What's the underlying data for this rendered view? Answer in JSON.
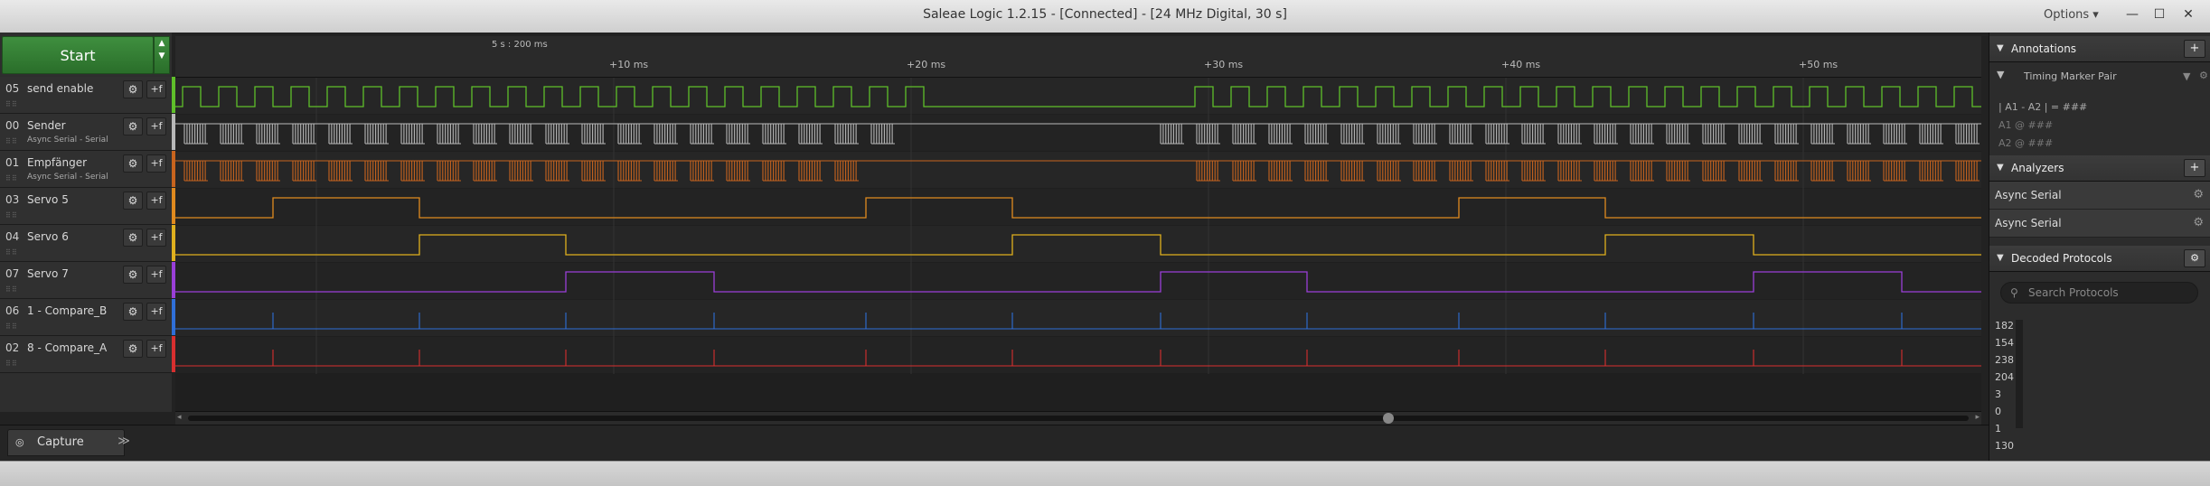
{
  "window": {
    "title": "Saleae Logic 1.2.15 - [Connected] - [24 MHz Digital, 30 s]",
    "options_label": "Options ▾",
    "minimize": "—",
    "maximize": "☐",
    "close": "✕"
  },
  "toolbar": {
    "start_label": "Start"
  },
  "ruler": {
    "zero_label": "5 s : 200 ms",
    "ticks": [
      "+10 ms",
      "+20 ms",
      "+30 ms",
      "+40 ms",
      "+50 ms"
    ]
  },
  "channels": [
    {
      "num": "05",
      "name": "send enable",
      "sub": "",
      "color": "#5fbf2a"
    },
    {
      "num": "00",
      "name": "Sender",
      "sub": "Async Serial - Serial",
      "color": "#b8b8b8"
    },
    {
      "num": "01",
      "name": "Empfänger",
      "sub": "Async Serial - Serial",
      "color": "#c8641e"
    },
    {
      "num": "03",
      "name": "Servo 5",
      "sub": "",
      "color": "#e08a1e"
    },
    {
      "num": "04",
      "name": "Servo 6",
      "sub": "",
      "color": "#e0b01e"
    },
    {
      "num": "07",
      "name": "Servo 7",
      "sub": "",
      "color": "#9a3fd8"
    },
    {
      "num": "06",
      "name": "1 - Compare_B",
      "sub": "",
      "color": "#2f6fd8"
    },
    {
      "num": "02",
      "name": "8 - Compare_A",
      "sub": "",
      "color": "#d82f2f"
    }
  ],
  "tabs": {
    "capture_label": "Capture",
    "more_label": "≫"
  },
  "annotations": {
    "title": "Annotations",
    "add": "+",
    "marker_pair": "Timing Marker Pair",
    "formula": "| A1 - A2 | = ###",
    "a1": "A1  @  ###",
    "a2": "A2  @  ###"
  },
  "analyzers": {
    "title": "Analyzers",
    "add": "+",
    "items": [
      "Async Serial",
      "Async Serial"
    ]
  },
  "decoded": {
    "title": "Decoded Protocols",
    "search_placeholder": "Search Protocols",
    "values": [
      "182",
      "154",
      "238",
      "204",
      "3",
      "0",
      "1",
      "130"
    ]
  }
}
